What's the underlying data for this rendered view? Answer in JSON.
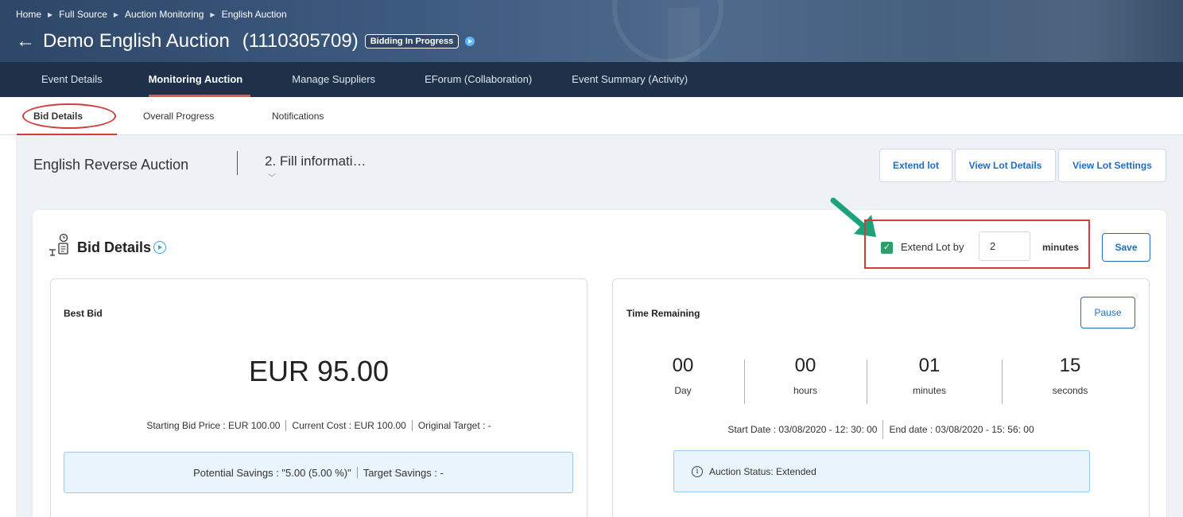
{
  "breadcrumb": [
    "Home",
    "Full Source",
    "Auction Monitoring",
    "English Auction"
  ],
  "header": {
    "title": "Demo English Auction",
    "id": "(1110305709)",
    "status": "Bidding In Progress"
  },
  "main_tabs": [
    "Event Details",
    "Monitoring Auction",
    "Manage Suppliers",
    "EForum (Collaboration)",
    "Event Summary (Activity)"
  ],
  "sub_tabs": [
    "Bid Details",
    "Overall Progress",
    "Notifications"
  ],
  "lot": {
    "title": "English Reverse Auction",
    "step": "2. Fill informati…"
  },
  "lot_buttons": [
    "Extend lot",
    "View Lot Details",
    "View Lot Settings"
  ],
  "bid_details": {
    "title": "Bid Details",
    "extend_label": "Extend Lot by",
    "extend_value": "2",
    "extend_unit": "minutes",
    "save_label": "Save"
  },
  "best_bid": {
    "title": "Best Bid",
    "amount": "EUR 95.00",
    "starting": "Starting Bid Price : EUR 100.00",
    "current": "Current Cost : EUR 100.00",
    "target": "Original Target : -",
    "potential": "Potential Savings : \"5.00 (5.00 %)\"",
    "target_savings": "Target Savings : -"
  },
  "time": {
    "title": "Time Remaining",
    "pause_label": "Pause",
    "day": "00",
    "day_label": "Day",
    "hours": "00",
    "hours_label": "hours",
    "minutes": "01",
    "minutes_label": "minutes",
    "seconds": "15",
    "seconds_label": "seconds",
    "start": "Start Date : 03/08/2020 - 12: 30: 00",
    "end": "End date : 03/08/2020 - 15: 56: 00",
    "status": "Auction Status: Extended"
  },
  "colors": {
    "accent_blue": "#1f6dc6",
    "highlight_red": "#d43c3c",
    "check_green": "#2f9e6b",
    "nav_dark": "#1e3148"
  }
}
